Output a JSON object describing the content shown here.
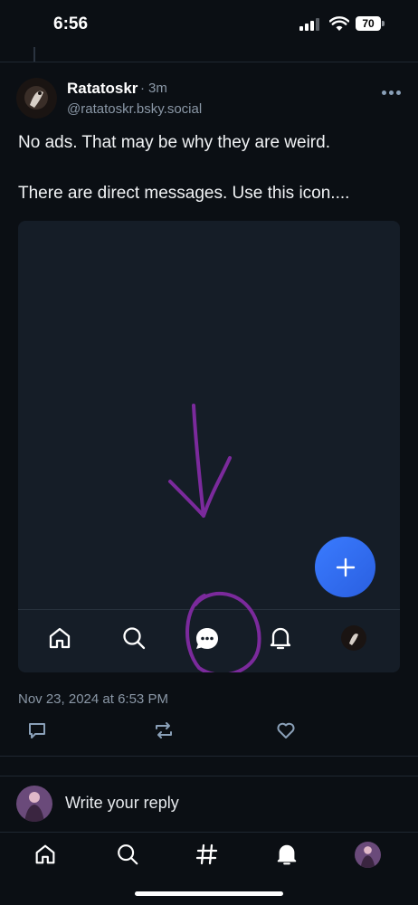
{
  "status_bar": {
    "time": "6:56",
    "battery": "70"
  },
  "post": {
    "author_name": "Ratatoskr",
    "separator": "·",
    "time_ago": "3m",
    "handle": "@ratatoskr.bsky.social",
    "text_line1": "No ads. That may be why they are weird.",
    "text_line2": "There are direct messages. Use this icon....",
    "timestamp": "Nov 23, 2024 at 6:53 PM"
  },
  "embed": {
    "nav_icons": [
      "home-icon",
      "search-icon",
      "chat-icon",
      "bell-icon",
      "avatar"
    ],
    "fab_icon": "plus-icon",
    "annotation": "purple hand-drawn arrow and circle around chat icon"
  },
  "reply": {
    "placeholder": "Write your reply"
  },
  "bottom_nav": {
    "icons": [
      "home-icon",
      "search-icon",
      "hashtag-icon",
      "bell-icon",
      "avatar"
    ]
  },
  "colors": {
    "background": "#0b0f14",
    "accent": "#3a7bff",
    "annotation": "#7b2a9c"
  }
}
